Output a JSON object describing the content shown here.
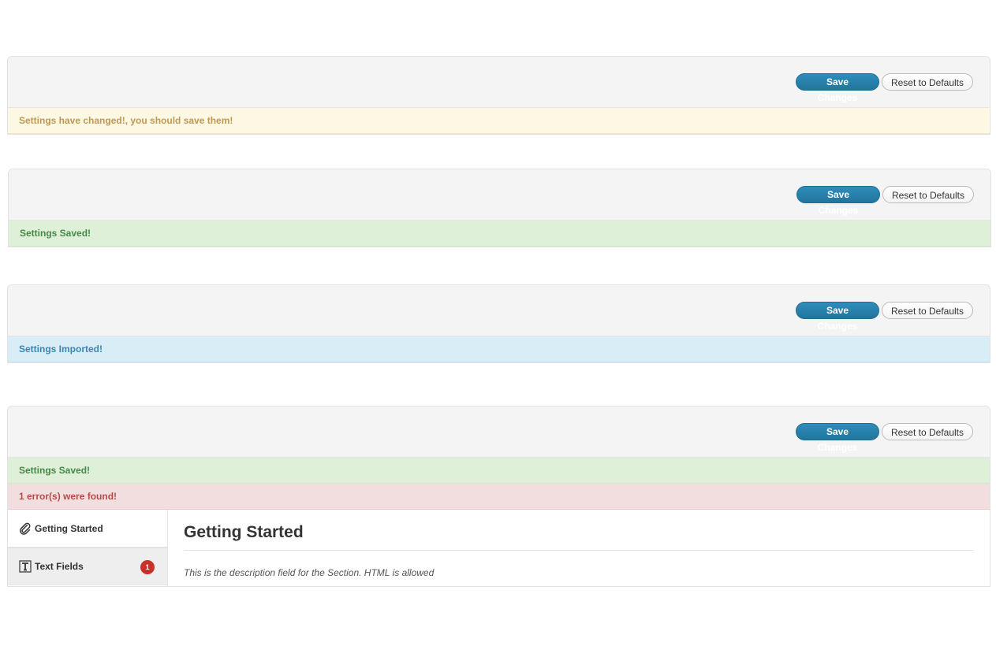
{
  "buttons": {
    "save_label": "Save Changes",
    "reset_label": "Reset to Defaults"
  },
  "panels": [
    {
      "notices": [
        {
          "type": "warn",
          "text": "Settings have changed!, you should save them!"
        }
      ]
    },
    {
      "notices": [
        {
          "type": "success",
          "text": "Settings Saved!"
        }
      ]
    },
    {
      "notices": [
        {
          "type": "info",
          "text": "Settings Imported!"
        }
      ]
    },
    {
      "notices": [
        {
          "type": "success",
          "text": "Settings Saved!"
        },
        {
          "type": "error",
          "text": "1 error(s) were found!"
        }
      ]
    }
  ],
  "sidebar": {
    "items": [
      {
        "label": "Getting Started",
        "icon": "paperclip-icon",
        "active": true
      },
      {
        "label": "Text Fields",
        "icon": "text-field-icon",
        "badge": "1",
        "active": false
      }
    ]
  },
  "section": {
    "title": "Getting Started",
    "description": "This is the description field for the Section. HTML is allowed"
  },
  "colors": {
    "primary": "#21759b",
    "warn_bg": "#fcf8e3",
    "success_bg": "#dff0d8",
    "info_bg": "#d9edf7",
    "error_bg": "#f2dede",
    "badge": "#c9302c"
  }
}
